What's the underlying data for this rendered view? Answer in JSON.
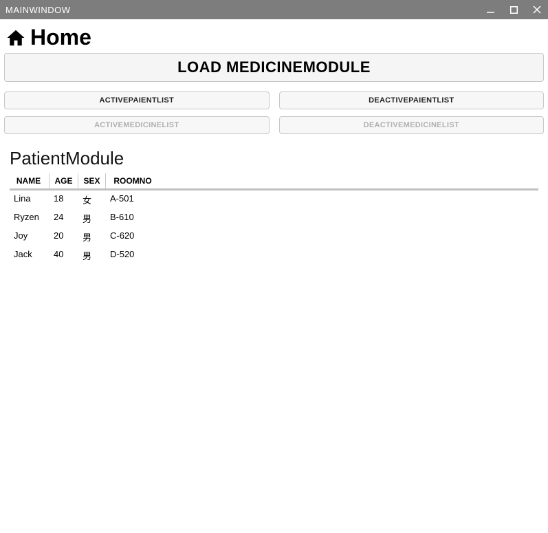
{
  "window": {
    "title": "MAINWINDOW"
  },
  "header": {
    "title": "Home"
  },
  "buttons": {
    "load_medicine": "LOAD MEDICINEMODULE",
    "active_patient": "ACTIVEPAIENTLIST",
    "deactive_patient": "DEACTIVEPAIENTLIST",
    "active_medicine": "ACTIVEMEDICINELIST",
    "deactive_medicine": "DEACTIVEMEDICINELIST"
  },
  "module": {
    "title": "PatientModule",
    "columns": {
      "name": "NAME",
      "age": "AGE",
      "sex": "SEX",
      "roomno": "ROOMNO"
    },
    "rows": [
      {
        "name": "Lina",
        "age": "18",
        "sex": "女",
        "roomno": "A-501"
      },
      {
        "name": "Ryzen",
        "age": "24",
        "sex": "男",
        "roomno": "B-610"
      },
      {
        "name": "Joy",
        "age": "20",
        "sex": "男",
        "roomno": "C-620"
      },
      {
        "name": "Jack",
        "age": "40",
        "sex": "男",
        "roomno": "D-520"
      }
    ]
  }
}
